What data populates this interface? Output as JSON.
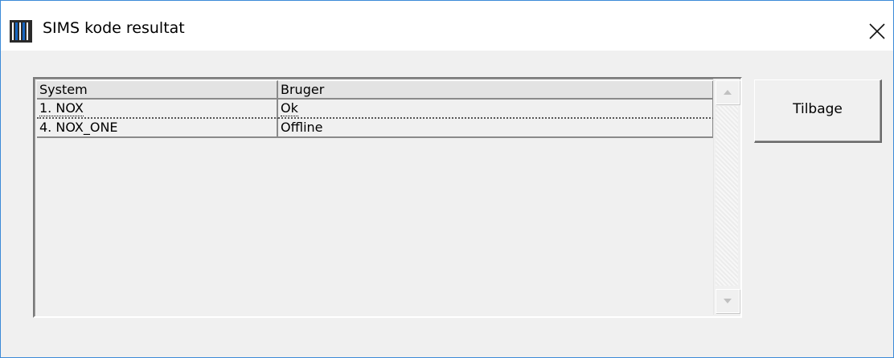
{
  "window": {
    "title": "SIMS kode resultat",
    "icon": "barcode-icon",
    "close_icon": "close-icon",
    "accent_color": "#3c8ad8"
  },
  "table": {
    "columns": [
      "System",
      "Bruger"
    ],
    "rows": [
      [
        "1. NOX",
        "Ok"
      ],
      [
        "4. NOX_ONE",
        "Offline"
      ]
    ]
  },
  "buttons": {
    "back_label": "Tilbage"
  }
}
